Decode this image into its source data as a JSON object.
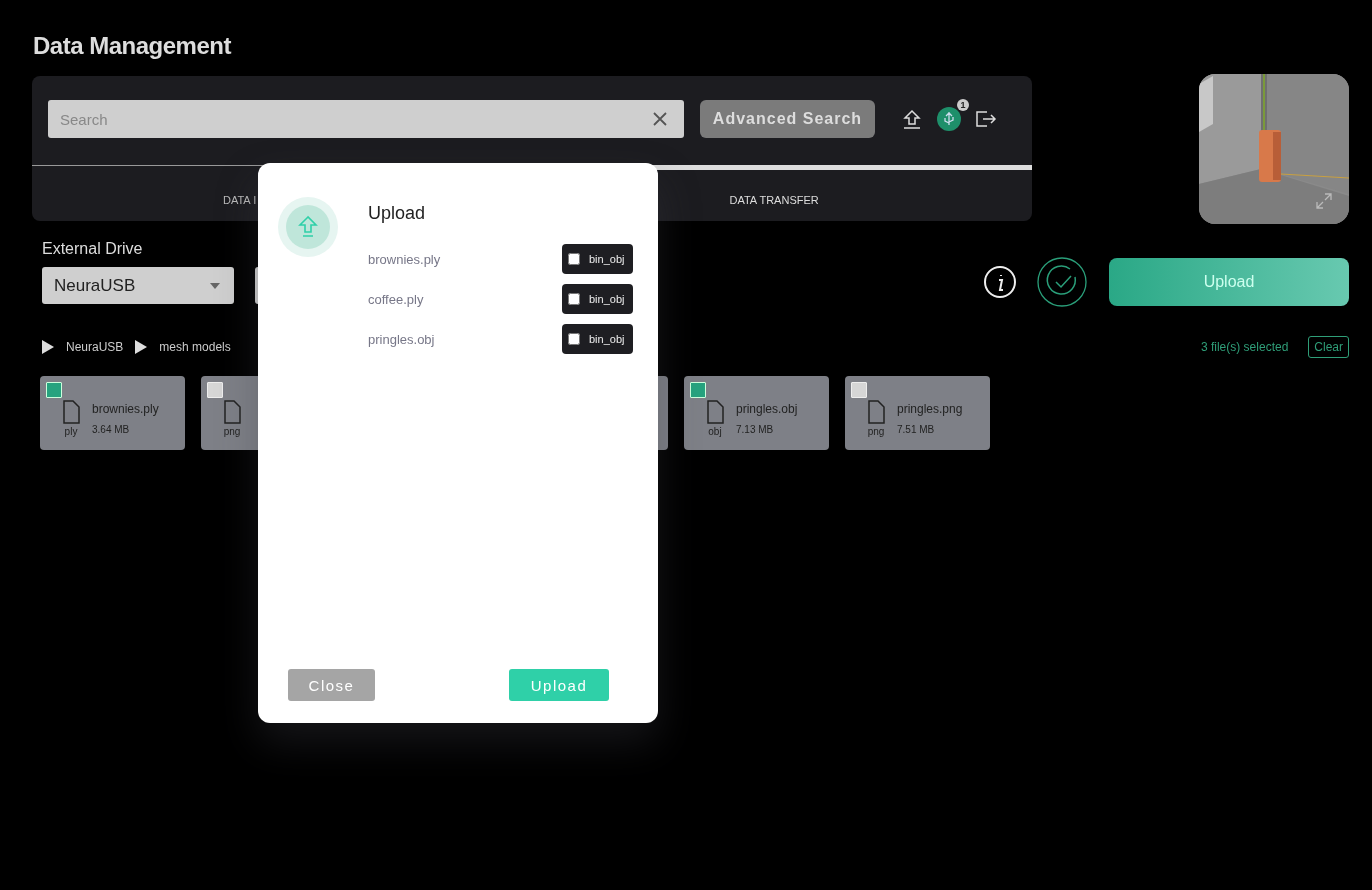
{
  "page_title": "Data Management",
  "search": {
    "placeholder": "Search"
  },
  "advanced_search": "Advanced Search",
  "toolbar": {
    "badge": "1"
  },
  "tabs": [
    {
      "label": "DATA I",
      "selected": false
    },
    {
      "label": "DATA TRANSFER",
      "selected": true
    }
  ],
  "preview": {
    "kind": "picture"
  },
  "external_drive": {
    "label": "External Drive",
    "value": "NeuraUSB"
  },
  "upload_button": "Upload",
  "breadcrumb": [
    "NeuraUSB",
    "mesh models"
  ],
  "selection": {
    "count": "3 file(s) selected",
    "clear": "Clear"
  },
  "files": [
    {
      "kind": "file",
      "checked": true,
      "ext": "ply",
      "name": "brownies.ply",
      "size": "3.64 MB"
    },
    {
      "kind": "file",
      "checked": false,
      "ext": "png"
    },
    {
      "kind": "covered"
    },
    {
      "kind": "file",
      "checked": true,
      "ext": "obj",
      "name": "pringles.obj",
      "size": "7.13 MB"
    },
    {
      "kind": "file",
      "checked": false,
      "ext": "png",
      "name": "pringles.png",
      "size": "7.51 MB"
    }
  ],
  "dialog": {
    "title": "Upload",
    "files": [
      {
        "name": "brownies.ply",
        "tag": "bin_obj",
        "checked": false
      },
      {
        "name": "coffee.ply",
        "tag": "bin_obj",
        "checked": false
      },
      {
        "name": "pringles.obj",
        "tag": "bin_obj",
        "checked": false
      }
    ],
    "buttons": [
      {
        "label": "Close",
        "kind": "secondary"
      },
      {
        "label": "Upload",
        "kind": "primary"
      }
    ]
  }
}
